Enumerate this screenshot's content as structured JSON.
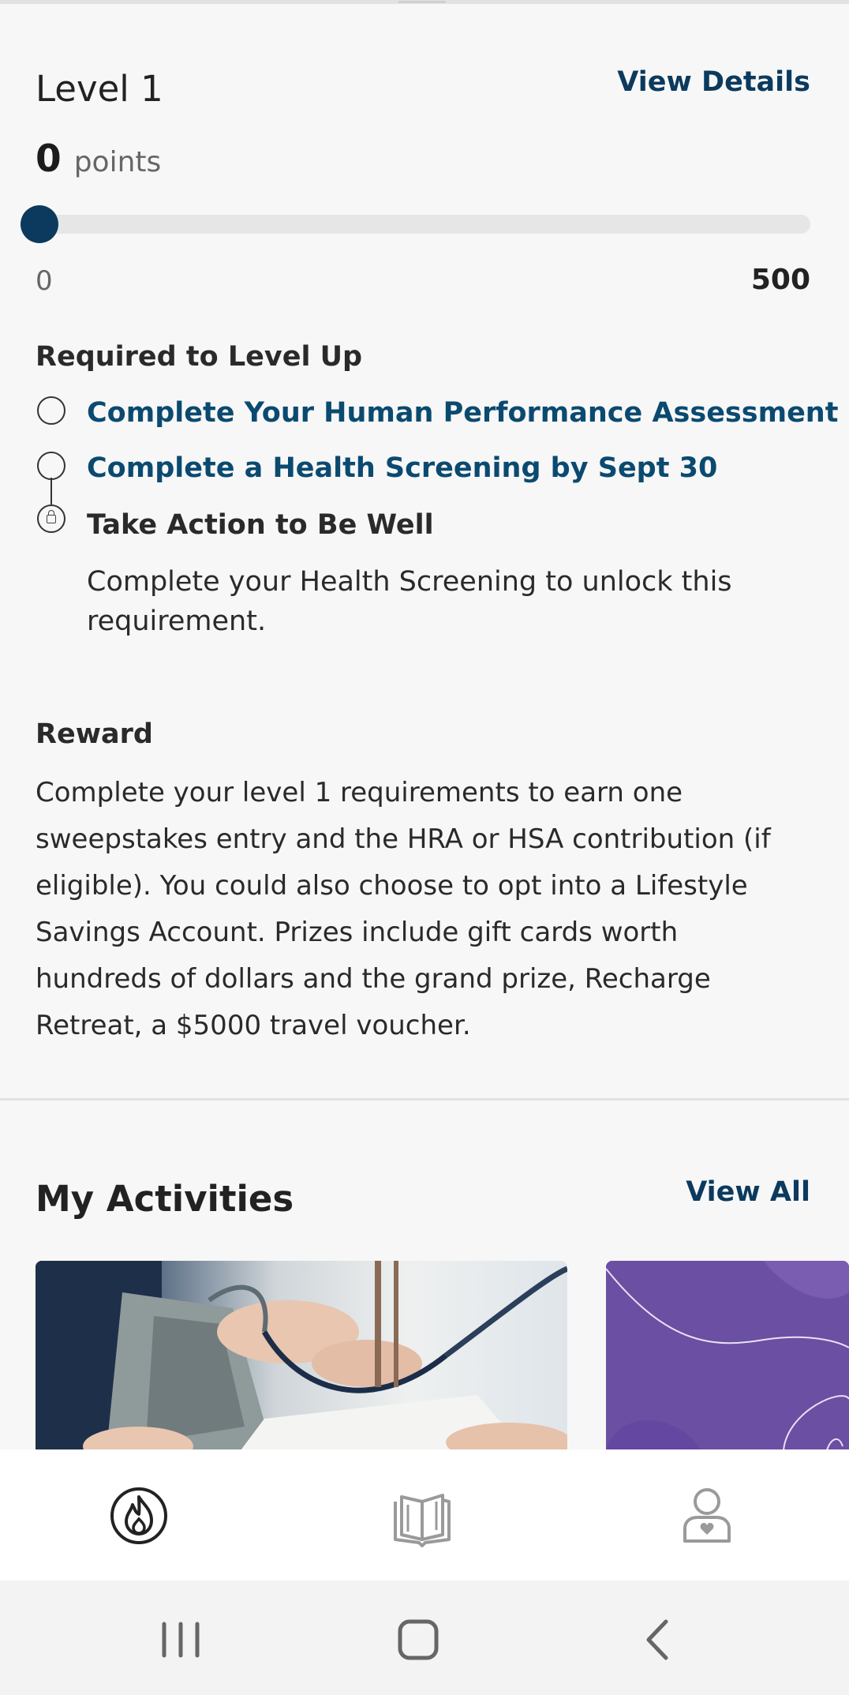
{
  "level": {
    "title": "Level 1",
    "view_details_label": "View Details",
    "points_value": "0",
    "points_label": "points",
    "progress_fraction": 0,
    "range_min": "0",
    "range_max": "500"
  },
  "requirements": {
    "title": "Required to Level Up",
    "items": [
      {
        "label": "Complete Your Human Performance Assessment",
        "state": "incomplete"
      },
      {
        "label": "Complete a Health Screening by Sept 30",
        "state": "incomplete"
      },
      {
        "label": "Take Action to Be Well",
        "state": "locked"
      }
    ],
    "locked_note": "Complete your Health Screening to unlock this requirement."
  },
  "reward": {
    "title": "Reward",
    "text": "Complete your level 1 requirements to earn one sweepstakes entry and the HRA or HSA contribution (if eligible). You could also choose to opt into a Lifestyle Savings Account. Prizes include gift cards worth hundreds of dollars and the grand prize, Recharge Retreat, a $5000 travel voucher."
  },
  "activities": {
    "title": "My Activities",
    "view_all_label": "View All"
  },
  "bottom_nav": {
    "items": [
      {
        "icon": "flame-icon",
        "active": true
      },
      {
        "icon": "book-icon",
        "active": false
      },
      {
        "icon": "profile-heart-icon",
        "active": false
      }
    ]
  },
  "colors": {
    "accent": "#0b3a5e",
    "link": "#0b4a70",
    "card_purple": "#6b4fa3"
  }
}
